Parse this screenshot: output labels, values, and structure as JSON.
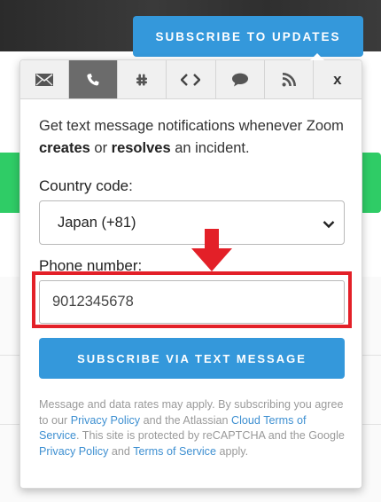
{
  "header": {
    "subscribe_button": "SUBSCRIBE TO UPDATES"
  },
  "tabs": [
    {
      "icon": "email-icon",
      "active": false
    },
    {
      "icon": "phone-icon",
      "active": true
    },
    {
      "icon": "slack-icon",
      "active": false
    },
    {
      "icon": "code-icon",
      "active": false
    },
    {
      "icon": "chat-icon",
      "active": false
    },
    {
      "icon": "rss-icon",
      "active": false
    },
    {
      "icon": "close-icon",
      "label": "x",
      "active": false
    }
  ],
  "sms": {
    "desc_1": "Get text message notifications whenever Zoom ",
    "desc_creates": "creates",
    "desc_2": " or ",
    "desc_resolves": "resolves",
    "desc_3": " an incident.",
    "country_label": "Country code:",
    "country_value": "Japan (+81)",
    "phone_label": "Phone number:",
    "phone_value": "9012345678",
    "submit_label": "SUBSCRIBE VIA TEXT MESSAGE"
  },
  "legal": {
    "t1": "Message and data rates may apply. By subscribing you agree to our ",
    "privacy_link": "Privacy Policy",
    "t2": " and the Atlassian ",
    "cloud_terms_link": "Cloud Terms of Service",
    "t3": ". This site is protected by reCAPTCHA and the Google ",
    "google_privacy_link": "Privacy Policy",
    "t4": " and ",
    "google_terms_link": "Terms of Service",
    "t5": " apply."
  },
  "colors": {
    "accent_blue": "#3498db",
    "highlight_red": "#e32028",
    "active_tab": "#6b6b6b",
    "status_green": "#2fcc66"
  }
}
